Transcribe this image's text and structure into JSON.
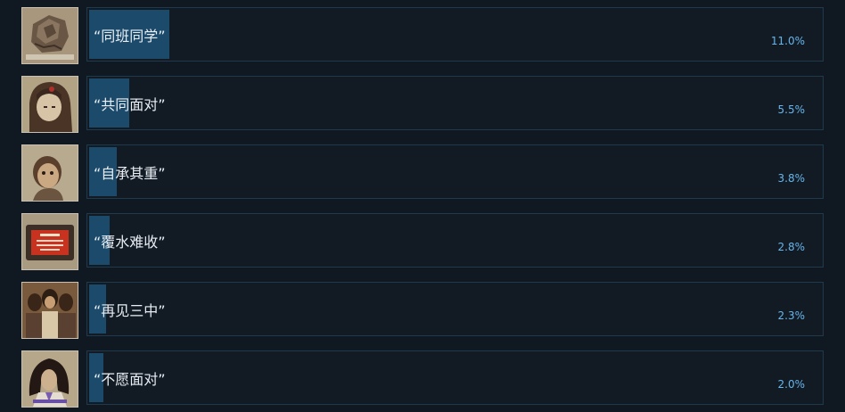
{
  "achievements": [
    {
      "name": "“同班同学”",
      "percent_label": "11.0%",
      "percent": 11.0,
      "icon": "crumpled-paper-icon"
    },
    {
      "name": "“共同面对”",
      "percent_label": "5.5%",
      "percent": 5.5,
      "icon": "girl-portrait-icon"
    },
    {
      "name": "“自承其重”",
      "percent_label": "3.8%",
      "percent": 3.8,
      "icon": "child-portrait-icon"
    },
    {
      "name": "“覆水难收”",
      "percent_label": "2.8%",
      "percent": 2.8,
      "icon": "red-screen-tv-icon"
    },
    {
      "name": "“再见三中”",
      "percent_label": "2.3%",
      "percent": 2.3,
      "icon": "students-group-icon"
    },
    {
      "name": "“不愿面对”",
      "percent_label": "2.0%",
      "percent": 2.0,
      "icon": "schoolgirl-icon"
    }
  ],
  "colors": {
    "background": "#101822",
    "bar_fill": "#1c4a6b",
    "bar_border": "#1f3a4d",
    "percent_text": "#66b6ec"
  }
}
